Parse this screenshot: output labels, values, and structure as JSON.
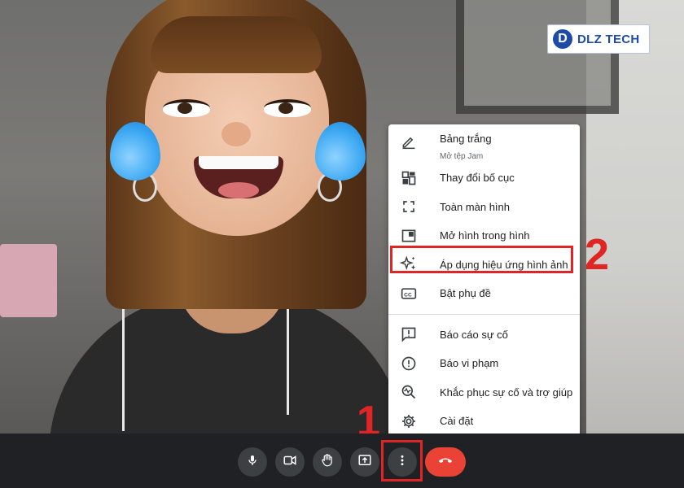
{
  "logo": {
    "mark": "D",
    "text": "DLZ TECH"
  },
  "menu": {
    "items": [
      {
        "id": "whiteboard",
        "label": "Bảng trắng",
        "sub": "Mở tệp Jam",
        "icon": "pencil-icon"
      },
      {
        "id": "change-layout",
        "label": "Thay đổi bố cục",
        "icon": "layout-icon"
      },
      {
        "id": "fullscreen",
        "label": "Toàn màn hình",
        "icon": "fullscreen-icon"
      },
      {
        "id": "picture-in-picture",
        "label": "Mở hình trong hình",
        "icon": "pip-icon"
      },
      {
        "id": "visual-effects",
        "label": "Áp dụng hiệu ứng hình ảnh",
        "icon": "sparkle-icon"
      },
      {
        "id": "captions",
        "label": "Bật phụ đề",
        "icon": "captions-icon"
      },
      {
        "id": "report-problem",
        "label": "Báo cáo sự cố",
        "icon": "feedback-icon"
      },
      {
        "id": "report-abuse",
        "label": "Báo vi phạm",
        "icon": "alert-icon"
      },
      {
        "id": "troubleshooting",
        "label": "Khắc phục sự cố và trợ giúp",
        "icon": "troubleshoot-icon"
      },
      {
        "id": "settings",
        "label": "Cài đặt",
        "icon": "gear-icon"
      }
    ]
  },
  "annotations": {
    "step1": "1",
    "step2": "2"
  },
  "toolbar": {
    "buttons": [
      "microphone-icon",
      "camera-icon",
      "hand-icon",
      "present-icon",
      "more-vert-icon",
      "hangup-icon"
    ]
  },
  "colors": {
    "highlight": "#e02525",
    "hangup": "#ea4335",
    "toolbar": "#202124",
    "button": "#3c4043"
  }
}
